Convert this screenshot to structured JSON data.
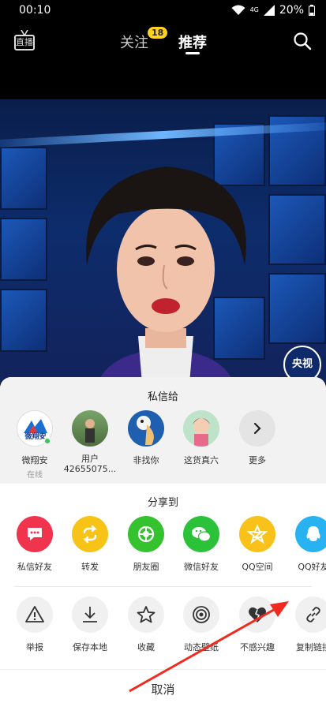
{
  "status_bar": {
    "time": "00:10",
    "network": "4G",
    "battery": "20%"
  },
  "nav": {
    "live_label": "直播",
    "follow_label": "关注",
    "follow_badge": "18",
    "recommend_label": "推荐"
  },
  "video": {
    "channel_badge": "央视"
  },
  "sheet": {
    "private_message_title": "私信给",
    "contacts": [
      {
        "name": "微翔安",
        "sub": "在线",
        "avatar_text": "微翔安"
      },
      {
        "name": "用户42655075...",
        "sub": ""
      },
      {
        "name": "非找你",
        "sub": ""
      },
      {
        "name": "这货真六",
        "sub": ""
      },
      {
        "name": "更多",
        "sub": ""
      }
    ],
    "share_title": "分享到",
    "share_targets": [
      {
        "label": "私信好友",
        "icon": "chat-bubble-icon",
        "color": "#f0344e"
      },
      {
        "label": "转发",
        "icon": "repost-icon",
        "color": "#f7c317"
      },
      {
        "label": "朋友圈",
        "icon": "moments-icon",
        "color": "#35c22f"
      },
      {
        "label": "微信好友",
        "icon": "wechat-icon",
        "color": "#2bc23a"
      },
      {
        "label": "QQ空间",
        "icon": "qzone-icon",
        "color": "#f8c21b"
      },
      {
        "label": "QQ好友",
        "icon": "qq-icon",
        "color": "#28b2f1"
      }
    ],
    "actions": [
      {
        "label": "举报",
        "icon": "warning-icon"
      },
      {
        "label": "保存本地",
        "icon": "download-icon"
      },
      {
        "label": "收藏",
        "icon": "star-icon"
      },
      {
        "label": "动态壁纸",
        "icon": "wallpaper-icon"
      },
      {
        "label": "不感兴趣",
        "icon": "broken-heart-icon"
      },
      {
        "label": "复制链接",
        "icon": "link-icon"
      }
    ],
    "cancel_label": "取消"
  }
}
